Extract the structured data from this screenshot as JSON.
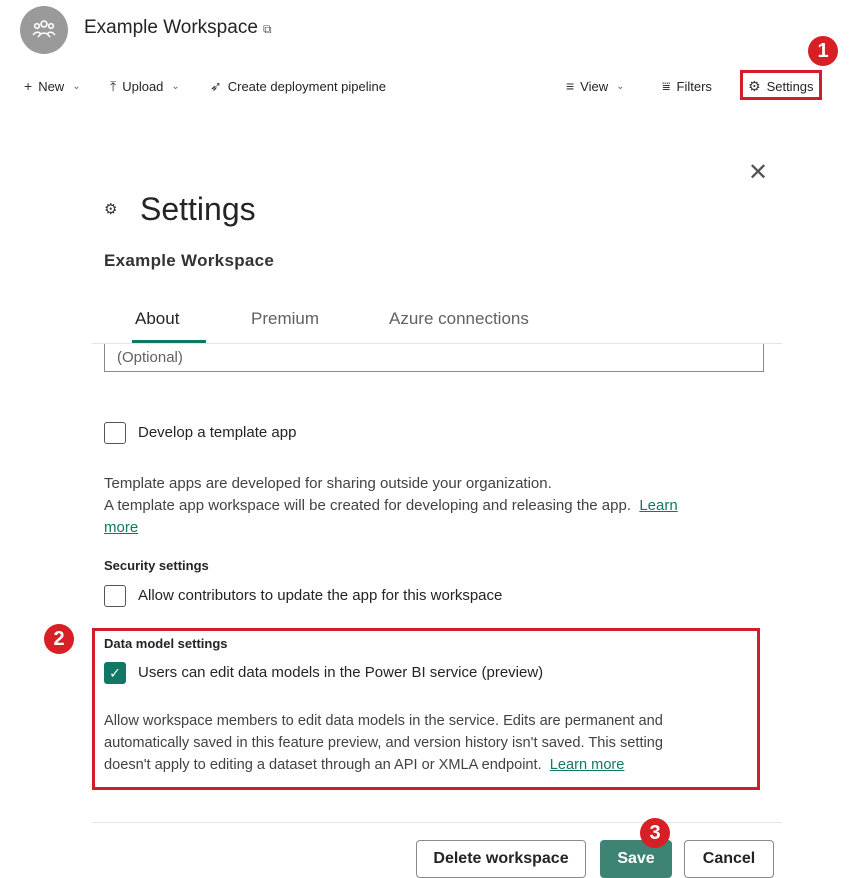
{
  "workspace": {
    "name": "Example Workspace",
    "name_icon": "⧉"
  },
  "toolbar": {
    "new_label": "New",
    "upload_label": "Upload",
    "pipeline_label": "Create deployment pipeline",
    "view_label": "View",
    "filters_label": "Filters",
    "settings_label": "Settings"
  },
  "badges": [
    "1",
    "2",
    "3"
  ],
  "dialog": {
    "title": "Settings",
    "subtitle": "Example Workspace",
    "tabs": [
      {
        "label": "About"
      },
      {
        "label": "Premium"
      },
      {
        "label": "Azure connections"
      }
    ],
    "description_placeholder": "(Optional)",
    "template_app_label": "Develop a template app",
    "template_info_line1": "Template apps are developed for sharing outside your organization.",
    "template_info_line2": "A template app workspace will be created for developing and releasing the app.",
    "learn_more_1a": "Learn",
    "learn_more_1b": "more",
    "security_heading": "Security settings",
    "security_checkbox_label": "Allow contributors to update the app for this workspace",
    "data_model_heading": "Data model settings",
    "data_model_checkbox_label": "Users can edit data models in the Power BI service (preview)",
    "data_model_info_line1": "Allow workspace members to edit data models in the service. Edits are permanent and",
    "data_model_info_line2": "automatically saved in this feature preview, and version history isn't saved. This setting",
    "data_model_info_line3": "doesn't apply to editing a dataset through an API or XMLA endpoint.",
    "learn_more_2": "Learn more",
    "delete_label": "Delete workspace",
    "save_label": "Save",
    "cancel_label": "Cancel"
  },
  "colors": {
    "accent": "#117865",
    "highlight": "#d11c2a",
    "primary_button": "#3d8474"
  }
}
